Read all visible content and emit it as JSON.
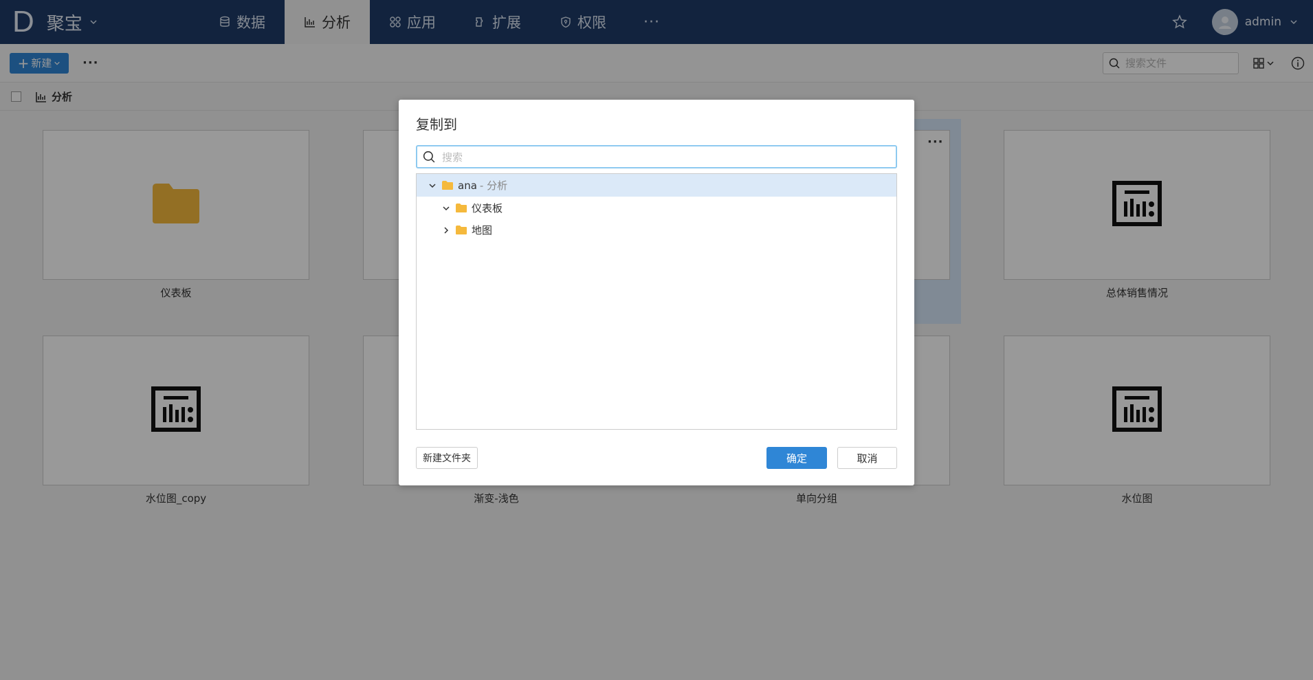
{
  "nav": {
    "logo": "D",
    "brand": "聚宝",
    "items": [
      {
        "label": "数据",
        "icon": "database-icon"
      },
      {
        "label": "分析",
        "icon": "bar-chart-icon",
        "active": true
      },
      {
        "label": "应用",
        "icon": "apps-icon"
      },
      {
        "label": "扩展",
        "icon": "puzzle-icon"
      },
      {
        "label": "权限",
        "icon": "shield-icon"
      }
    ],
    "more": "···",
    "username": "admin"
  },
  "toolbar": {
    "new_label": "新建",
    "more": "···",
    "search_placeholder": "搜索文件"
  },
  "breadcrumb": {
    "label": "分析"
  },
  "tiles": [
    {
      "label": "仪表板",
      "icon": "folder-icon"
    },
    {
      "label": "总体销售情况",
      "icon": "report-icon"
    },
    {
      "label": "水位图_copy",
      "icon": "report-icon"
    },
    {
      "label": "渐变-浅色",
      "icon": "report-icon"
    },
    {
      "label": "单向分组",
      "icon": "report-icon"
    },
    {
      "label": "水位图",
      "icon": "report-icon"
    }
  ],
  "tile_more": "···",
  "modal": {
    "title": "复制到",
    "search_placeholder": "搜索",
    "tree": [
      {
        "label": "ana",
        "sub": "- 分析",
        "expanded": true,
        "selected": true
      },
      {
        "label": "仪表板",
        "expanded": true
      },
      {
        "label": "地图",
        "expanded": false
      }
    ],
    "new_folder_label": "新建文件夹",
    "ok_label": "确定",
    "cancel_label": "取消"
  },
  "colors": {
    "nav_bg": "#1f3b68",
    "primary": "#2f86d6",
    "folder": "#f5b93c"
  }
}
